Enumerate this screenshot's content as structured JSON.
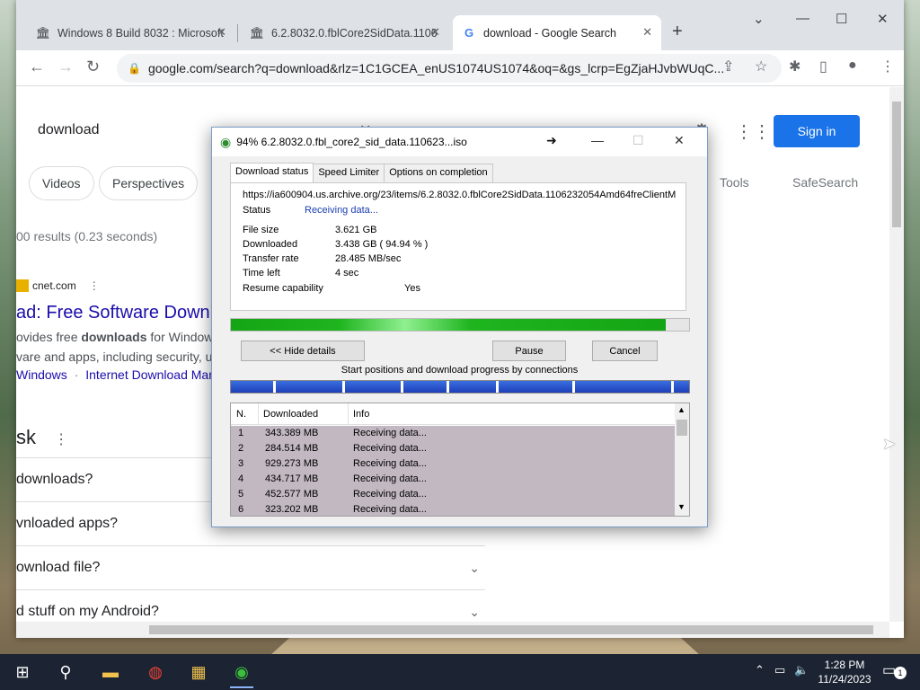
{
  "browser": {
    "tabs": [
      {
        "title": "Windows 8 Build 8032 : Microsoft",
        "icon": "archive-icon"
      },
      {
        "title": "6.2.8032.0.fblCore2SidData.1106",
        "icon": "archive-icon"
      },
      {
        "title": "download - Google Search",
        "icon": "google-icon"
      }
    ],
    "url": "google.com/search?q=download&rlz=1C1GCEA_enUS1074US1074&oq=&gs_lcrp=EgZjaHJvbWUqC..."
  },
  "google": {
    "query": "download",
    "sign_in": "Sign in",
    "chips": [
      "Videos",
      "Perspectives"
    ],
    "tools": "Tools",
    "safesearch": "SafeSearch",
    "stats": "00 results (0.23 seconds)",
    "result": {
      "site": "cnet.com",
      "title": "ad: Free Software Downl",
      "snippet1_pre": "ovides free ",
      "snippet1_bold": "downloads",
      "snippet1_post": " for Windows",
      "snippet2": "vare and apps, including security, u",
      "sitelink1": "Windows",
      "sitelink_sep": "·",
      "sitelink2": "Internet Download Mana"
    },
    "paa_heading": "sk",
    "paa": [
      "downloads?",
      "vnloaded apps?",
      "ownload file?",
      "d stuff on my Android?"
    ]
  },
  "idm": {
    "title": "94% 6.2.8032.0.fbl_core2_sid_data.110623...iso",
    "tabs": [
      "Download status",
      "Speed Limiter",
      "Options on completion"
    ],
    "url": "https://ia600904.us.archive.org/23/items/6.2.8032.0.fblCore2SidData.1106232054Amd64freClientM",
    "status_label": "Status",
    "status_value": "Receiving data...",
    "file_size_label": "File size",
    "file_size_value": "3.621  GB",
    "downloaded_label": "Downloaded",
    "downloaded_value": "3.438  GB  ( 94.94 % )",
    "transfer_label": "Transfer rate",
    "transfer_value": "28.485  MB/sec",
    "time_left_label": "Time left",
    "time_left_value": "4 sec",
    "resume_label": "Resume capability",
    "resume_value": "Yes",
    "progress": 0.9494,
    "hide_details": "<< Hide details",
    "pause": "Pause",
    "cancel": "Cancel",
    "connections_label": "Start positions and download progress by connections",
    "columns": [
      "N.",
      "Downloaded",
      "Info"
    ],
    "connections": [
      {
        "n": "1",
        "downloaded": "343.389  MB",
        "info": "Receiving data..."
      },
      {
        "n": "2",
        "downloaded": "284.514  MB",
        "info": "Receiving data..."
      },
      {
        "n": "3",
        "downloaded": "929.273  MB",
        "info": "Receiving data..."
      },
      {
        "n": "4",
        "downloaded": "434.717  MB",
        "info": "Receiving data..."
      },
      {
        "n": "5",
        "downloaded": "452.577  MB",
        "info": "Receiving data..."
      },
      {
        "n": "6",
        "downloaded": "323.202  MB",
        "info": "Receiving data..."
      }
    ]
  },
  "taskbar": {
    "time": "1:28 PM",
    "date": "11/24/2023",
    "notifications": "1"
  }
}
